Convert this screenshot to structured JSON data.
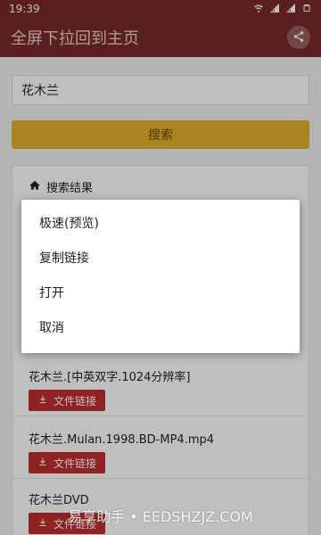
{
  "status_bar": {
    "time": "19:39"
  },
  "app_bar": {
    "title": "全屏下拉回到主页"
  },
  "search": {
    "value": "花木兰",
    "button_label": "搜索"
  },
  "results": {
    "header": "搜索结果",
    "items": [
      {
        "title": "花木兰.[中英双字.1024分辨率]",
        "link_label": "文件链接"
      },
      {
        "title": "花木兰.Mulan.1998.BD-MP4.mp4",
        "link_label": "文件链接"
      },
      {
        "title": "花木兰DVD",
        "link_label": "文件链接"
      }
    ]
  },
  "context_menu": {
    "items": [
      "极速(预览)",
      "复制链接",
      "打开",
      "取消"
    ]
  },
  "watermark": "易享助手 • EEDSHZJZ.COM",
  "colors": {
    "app_bar": "#7a2a2a",
    "search_button": "#e0b22a",
    "file_link_button": "#bf2f2f"
  },
  "icons": {
    "share": "share-icon",
    "home": "home-icon",
    "download": "download-icon"
  }
}
